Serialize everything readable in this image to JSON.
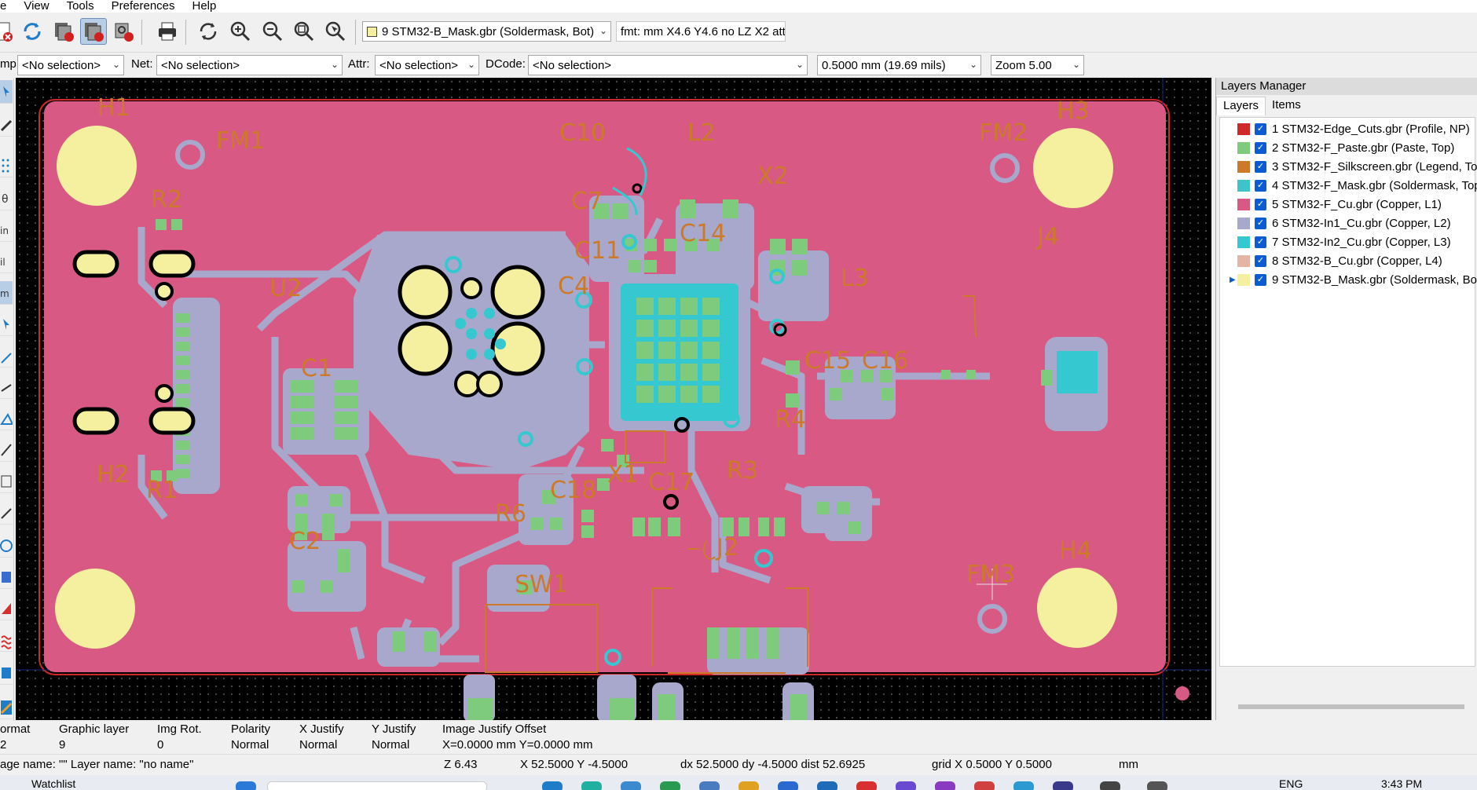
{
  "menu": [
    "e",
    "View",
    "Tools",
    "Preferences",
    "Help"
  ],
  "toolbar": {
    "active_layer": "9 STM32-B_Mask.gbr (Soldermask, Bot)",
    "active_layer_color": "#f4f0a0",
    "format_info": "fmt: mm X4.6 Y4.6 no LZ X2 attr"
  },
  "filters": {
    "cmp_label": "mp:",
    "cmp_value": "<No selection>",
    "net_label": "Net:",
    "net_value": "<No selection>",
    "attr_label": "Attr:",
    "attr_value": "<No selection>",
    "dcode_label": "DCode:",
    "dcode_value": "<No selection>",
    "grid_value": "0.5000 mm (19.69 mils)",
    "zoom_value": "Zoom 5.00"
  },
  "layers_manager": {
    "title": "Layers Manager",
    "tabs": [
      "Layers",
      "Items"
    ],
    "layers": [
      {
        "label": "1 STM32-Edge_Cuts.gbr (Profile, NP)",
        "color": "#d02828"
      },
      {
        "label": "2 STM32-F_Paste.gbr (Paste, Top)",
        "color": "#7ecb7e"
      },
      {
        "label": "3 STM32-F_Silkscreen.gbr (Legend, Top)",
        "color": "#cc7a2a"
      },
      {
        "label": "4 STM32-F_Mask.gbr (Soldermask, Top)",
        "color": "#3cc4c8"
      },
      {
        "label": "5 STM32-F_Cu.gbr (Copper, L1)",
        "color": "#d85a84"
      },
      {
        "label": "6 STM32-In1_Cu.gbr (Copper, L2)",
        "color": "#a8a8cc"
      },
      {
        "label": "7 STM32-In2_Cu.gbr (Copper, L3)",
        "color": "#36c8d0"
      },
      {
        "label": "8 STM32-B_Cu.gbr (Copper, L4)",
        "color": "#e4b4a4"
      },
      {
        "label": "9 STM32-B_Mask.gbr (Soldermask, Bot)",
        "color": "#f4f0a0"
      }
    ]
  },
  "pcb_labels": [
    {
      "text": "H1",
      "id": "h1"
    },
    {
      "text": "FM1",
      "id": "fm1"
    },
    {
      "text": "R2",
      "id": "r2"
    },
    {
      "text": "U2",
      "id": "u2"
    },
    {
      "text": "R1",
      "id": "r1"
    },
    {
      "text": "C1",
      "id": "c1"
    },
    {
      "text": "C2",
      "id": "c2"
    },
    {
      "text": "H2",
      "id": "h2"
    },
    {
      "text": "C10",
      "id": "c10"
    },
    {
      "text": "L2",
      "id": "l2"
    },
    {
      "text": "X2",
      "id": "x2"
    },
    {
      "text": "C7",
      "id": "c7"
    },
    {
      "text": "C14",
      "id": "c14"
    },
    {
      "text": "C11",
      "id": "c11"
    },
    {
      "text": "C4",
      "id": "c4"
    },
    {
      "text": "L3",
      "id": "l3"
    },
    {
      "text": "C15",
      "id": "c15"
    },
    {
      "text": "C16",
      "id": "c16"
    },
    {
      "text": "R4",
      "id": "r4"
    },
    {
      "text": "C18",
      "id": "c18"
    },
    {
      "text": "X1",
      "id": "x1"
    },
    {
      "text": "C17",
      "id": "c17"
    },
    {
      "text": "R3",
      "id": "r3"
    },
    {
      "text": "R6",
      "id": "r6"
    },
    {
      "text": "SW1",
      "id": "sw1"
    },
    {
      "text": "J2",
      "id": "j2"
    },
    {
      "text": "FM2",
      "id": "fm2"
    },
    {
      "text": "H3",
      "id": "h3"
    },
    {
      "text": "J4",
      "id": "j4"
    },
    {
      "text": "FM3",
      "id": "fm3"
    },
    {
      "text": "H4",
      "id": "h4"
    }
  ],
  "info_panel": {
    "col1_head": "ormat",
    "col1_val": "2",
    "col2_head": "Graphic layer",
    "col2_val": "9",
    "col3_head": "Img Rot.",
    "col3_val": "0",
    "col4_head": "Polarity",
    "col4_val": "Normal",
    "col5_head": "X Justify",
    "col5_val": "Normal",
    "col6_head": "Y Justify",
    "col6_val": "Normal",
    "col7_head": "Image Justify Offset",
    "col7_val": "X=0.0000 mm Y=0.0000 mm"
  },
  "status": {
    "image_name": "age name: \"\"  Layer name: \"no name\"",
    "z": "Z 6.43",
    "xy": "X 52.5000  Y -4.5000",
    "delta": "dx 52.5000  dy -4.5000  dist 52.6925",
    "grid": "grid X 0.5000  Y 0.5000",
    "units": "mm"
  },
  "taskbar": {
    "watchlist": "Watchlist",
    "lang": "ENG",
    "time": "3:43 PM"
  }
}
